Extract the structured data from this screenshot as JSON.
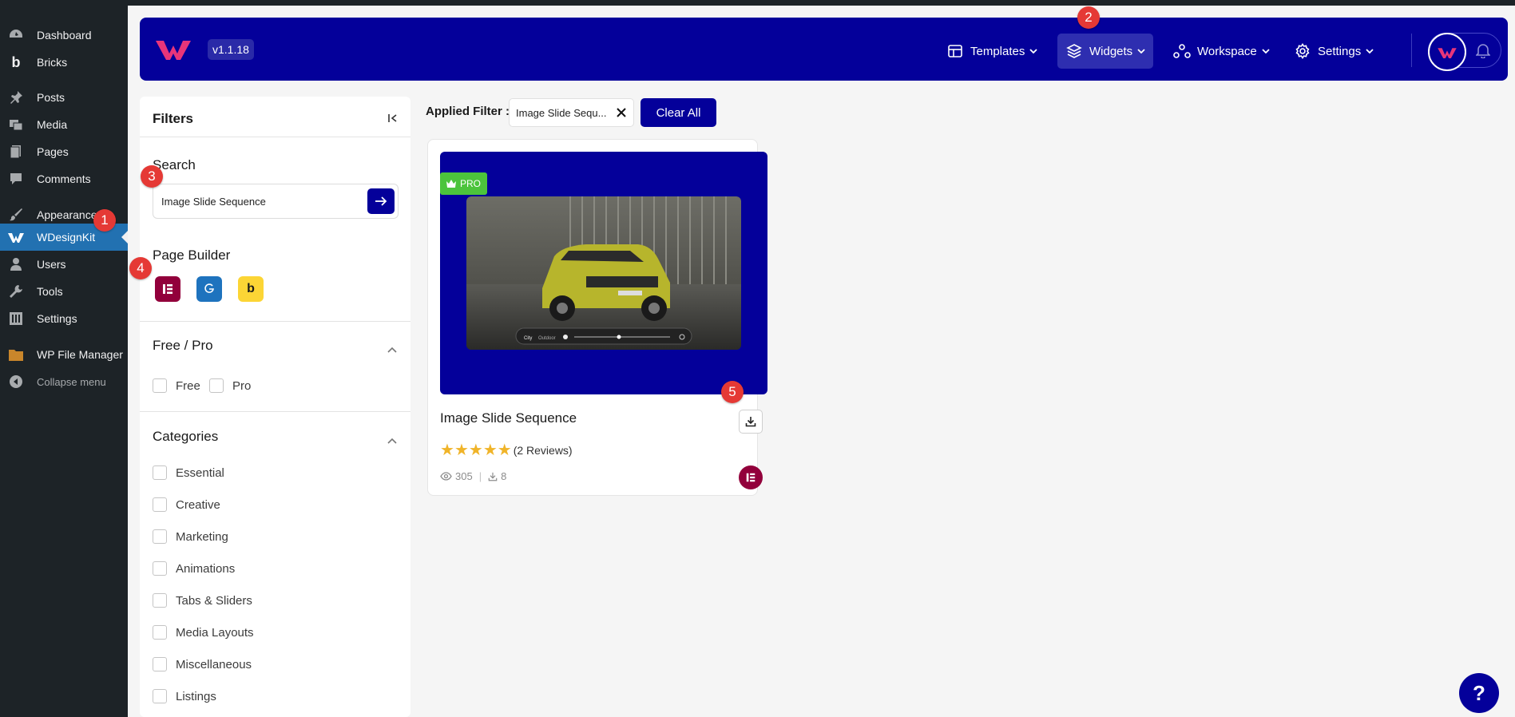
{
  "wp_sidebar": {
    "items": [
      {
        "label": "Dashboard",
        "icon": "dashboard-icon"
      },
      {
        "label": "Bricks",
        "icon": "bricks-icon"
      },
      {
        "label": "Posts",
        "icon": "pin-icon"
      },
      {
        "label": "Media",
        "icon": "media-icon"
      },
      {
        "label": "Pages",
        "icon": "pages-icon"
      },
      {
        "label": "Comments",
        "icon": "comments-icon"
      },
      {
        "label": "Appearance",
        "icon": "brush-icon"
      },
      {
        "label": "WDesignKit",
        "icon": "wdesignkit-icon",
        "active": true
      },
      {
        "label": "Users",
        "icon": "users-icon"
      },
      {
        "label": "Tools",
        "icon": "wrench-icon"
      },
      {
        "label": "Settings",
        "icon": "settings-icon"
      },
      {
        "label": "WP File Manager",
        "icon": "file-manager-icon"
      },
      {
        "label": "Collapse menu",
        "icon": "collapse-icon"
      }
    ]
  },
  "header": {
    "version": "v1.1.18",
    "nav": [
      {
        "label": "Templates",
        "icon": "templates-icon"
      },
      {
        "label": "Widgets",
        "icon": "layers-icon",
        "active": true
      },
      {
        "label": "Workspace",
        "icon": "workspace-icon"
      },
      {
        "label": "Settings",
        "icon": "gear-icon"
      }
    ]
  },
  "filters": {
    "title": "Filters",
    "search_label": "Search",
    "search_value": "Image Slide Sequence",
    "page_builder_label": "Page Builder",
    "page_builders": [
      {
        "name": "Elementor",
        "glyph": "E",
        "color": "#92003b"
      },
      {
        "name": "Gutenberg",
        "glyph": "G",
        "color": "#1e73be"
      },
      {
        "name": "Bricks",
        "glyph": "b",
        "color": "#fcd535"
      }
    ],
    "free_pro_label": "Free / Pro",
    "free_pro_options": [
      "Free",
      "Pro"
    ],
    "categories_label": "Categories",
    "categories": [
      "Essential",
      "Creative",
      "Marketing",
      "Animations",
      "Tabs & Sliders",
      "Media Layouts",
      "Miscellaneous",
      "Listings"
    ]
  },
  "applied_filter": {
    "label": "Applied Filter :",
    "chip": "Image Slide Sequ...",
    "clear_label": "Clear All"
  },
  "card": {
    "badge": "PRO",
    "title": "Image Slide Sequence",
    "rating": 5,
    "reviews": "(2 Reviews)",
    "views": "305",
    "downloads": "8",
    "preview_labels": [
      "City",
      "Outdoor"
    ]
  },
  "markers": [
    "1",
    "2",
    "3",
    "4",
    "5"
  ],
  "help_label": "?",
  "colors": {
    "brand": "#04009a",
    "wp_sidebar": "#1d2327",
    "wp_active": "#2271b1",
    "marker": "#e53935",
    "pro_badge": "#4cc43c",
    "star": "#f0b429"
  }
}
